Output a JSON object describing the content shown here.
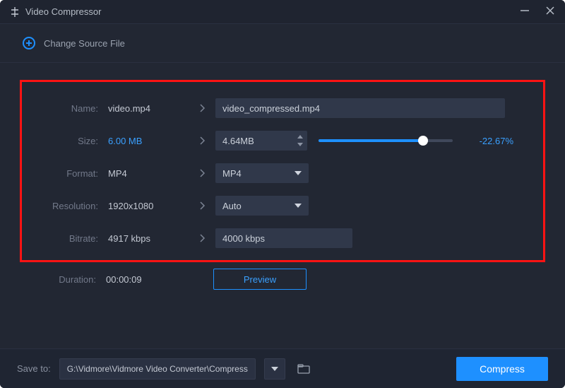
{
  "titlebar": {
    "title": "Video Compressor"
  },
  "actions": {
    "change_source": "Change Source File"
  },
  "labels": {
    "name": "Name:",
    "size": "Size:",
    "format": "Format:",
    "resolution": "Resolution:",
    "bitrate": "Bitrate:",
    "duration": "Duration:",
    "save_to": "Save to:"
  },
  "source": {
    "name": "video.mp4",
    "size": "6.00 MB",
    "format": "MP4",
    "resolution": "1920x1080",
    "bitrate": "4917 kbps",
    "duration": "00:00:09"
  },
  "output": {
    "name": "video_compressed.mp4",
    "size": "4.64MB",
    "size_delta_pct": "-22.67%",
    "format": "MP4",
    "resolution": "Auto",
    "bitrate": "4000 kbps"
  },
  "buttons": {
    "preview": "Preview",
    "compress": "Compress"
  },
  "save_path": "G:\\Vidmore\\Vidmore Video Converter\\Compressed"
}
